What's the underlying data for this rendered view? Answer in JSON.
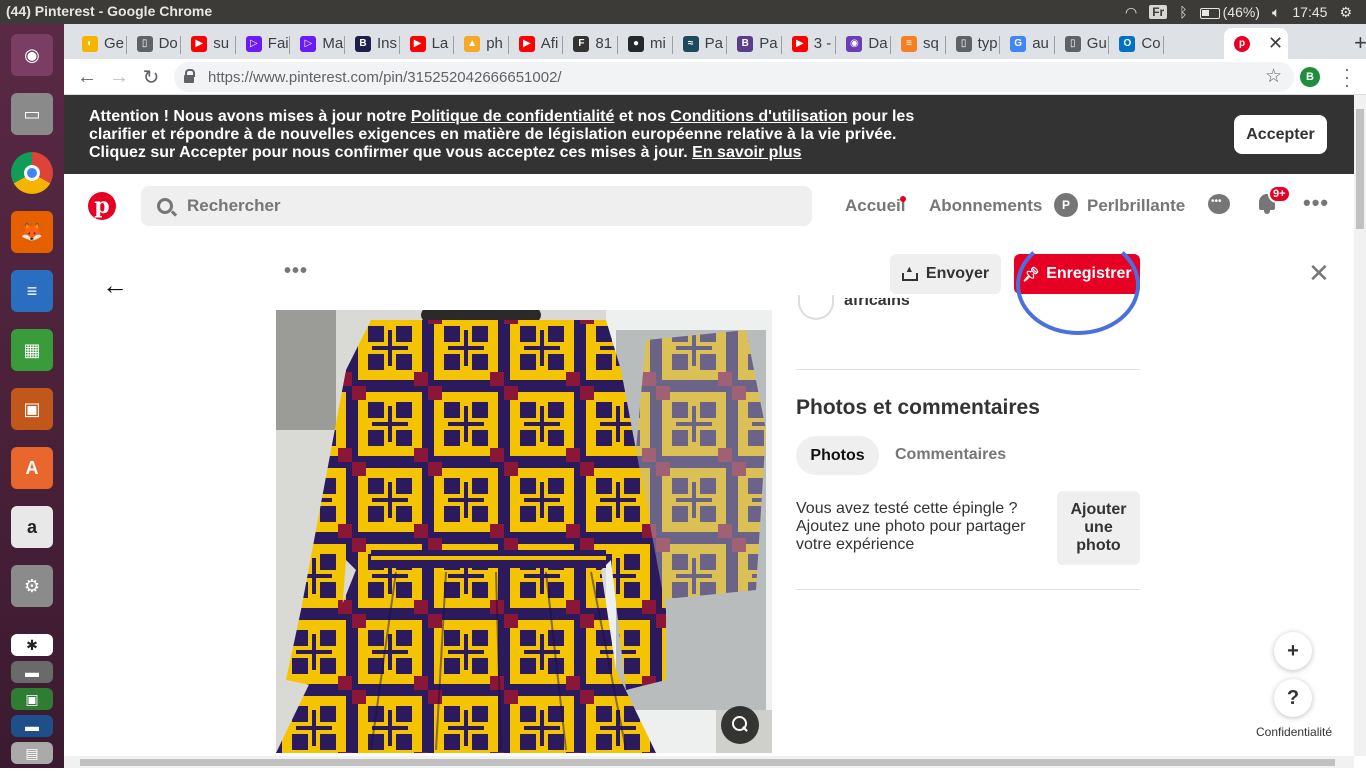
{
  "os": {
    "window_title": "(44) Pinterest - Google Chrome",
    "keyboard_layout": "Fr",
    "battery": "(46%)",
    "clock": "17:45"
  },
  "launcher": [
    {
      "name": "ubuntu-dash-icon",
      "color": "#7a3e65",
      "glyph": "◉"
    },
    {
      "name": "files-icon",
      "color": "#8a8a8a",
      "glyph": "▭"
    },
    {
      "name": "chrome-icon",
      "color": "#ffffff",
      "glyph": ""
    },
    {
      "name": "firefox-icon",
      "color": "#e66000",
      "glyph": "🦊"
    },
    {
      "name": "writer-icon",
      "color": "#2a6fbf",
      "glyph": "≡"
    },
    {
      "name": "calc-icon",
      "color": "#3a9b3a",
      "glyph": "▦"
    },
    {
      "name": "impress-icon",
      "color": "#c2571c",
      "glyph": "▣"
    },
    {
      "name": "software-center-icon",
      "color": "#e9672c",
      "glyph": "A"
    },
    {
      "name": "amazon-icon",
      "color": "#e8e8e8",
      "glyph": "a"
    },
    {
      "name": "settings-icon",
      "color": "#8b8b8b",
      "glyph": "⚙"
    },
    {
      "name": "slack-icon",
      "color": "#ffffff",
      "glyph": "✱"
    },
    {
      "name": "drive-icon",
      "color": "#6a6a6a",
      "glyph": "▬"
    },
    {
      "name": "screenshot-icon",
      "color": "#2e7d32",
      "glyph": "▣"
    },
    {
      "name": "scanner-icon",
      "color": "#1e4f8a",
      "glyph": "▬"
    },
    {
      "name": "trash-icon",
      "color": "#aaaaaa",
      "glyph": "▤"
    }
  ],
  "browser": {
    "tabs": [
      {
        "label": "Ge",
        "fav_color": "#f4b400",
        "fav": "◐"
      },
      {
        "label": "Do",
        "fav_color": "#5f6368",
        "fav": "▯"
      },
      {
        "label": "su",
        "fav_color": "#ff0000",
        "fav": "▶"
      },
      {
        "label": "Fai",
        "fav_color": "#6a1cf6",
        "fav": "▷"
      },
      {
        "label": "Ma",
        "fav_color": "#6a1cf6",
        "fav": "▷"
      },
      {
        "label": "Ins",
        "fav_color": "#1d1f4a",
        "fav": "B"
      },
      {
        "label": "La",
        "fav_color": "#ff0000",
        "fav": "▶"
      },
      {
        "label": "ph",
        "fav_color": "#f9a825",
        "fav": "▲"
      },
      {
        "label": "Afi",
        "fav_color": "#ff0000",
        "fav": "▶"
      },
      {
        "label": "81",
        "fav_color": "#333333",
        "fav": "F"
      },
      {
        "label": "mi",
        "fav_color": "#24292e",
        "fav": "●"
      },
      {
        "label": "Pa",
        "fav_color": "#1b4a5a",
        "fav": "≈"
      },
      {
        "label": "Pa",
        "fav_color": "#5c3b8a",
        "fav": "B"
      },
      {
        "label": "3 -",
        "fav_color": "#ff0000",
        "fav": "▶"
      },
      {
        "label": "Da",
        "fav_color": "#6a3fb5",
        "fav": "◉"
      },
      {
        "label": "sq",
        "fav_color": "#f48024",
        "fav": "≡"
      },
      {
        "label": "typ",
        "fav_color": "#5f6368",
        "fav": "▯"
      },
      {
        "label": "au",
        "fav_color": "#4285f4",
        "fav": "G"
      },
      {
        "label": "Gu",
        "fav_color": "#5f6368",
        "fav": "▯"
      },
      {
        "label": "Co",
        "fav_color": "#0072c6",
        "fav": "O"
      }
    ],
    "active_tab_close": "✕",
    "new_tab": "+",
    "url_host": "https://www.pinterest.com",
    "url_path": "/pin/315252042666651002/",
    "profile_initial": "B"
  },
  "consent": {
    "line1_a": "Attention ! Nous avons mises à jour notre ",
    "link_privacy": "Politique de confidentialité",
    "line1_b": " et nos ",
    "link_terms": "Conditions d'utilisation",
    "line1_c": " pour les",
    "line2": "clarifier et répondre à de nouvelles exigences en matière de législation européenne relative à la vie privée.",
    "line3_a": "Cliquez sur Accepter pour nous confirmer que vous acceptez ces mises à jour. ",
    "link_more": "En savoir plus",
    "accept_label": "Accepter"
  },
  "header": {
    "logo": "p",
    "search_placeholder": "Rechercher",
    "home": "Accueil",
    "following": "Abonnements",
    "avatar_initial": "P",
    "username": "Perlbrillante",
    "notif_badge": "9+",
    "more": "•••"
  },
  "pin": {
    "back": "←",
    "more": "•••",
    "send_label": "Envoyer",
    "save_label": "Enregistrer",
    "close": "✕",
    "board_name_partial": "africains",
    "photos_heading": "Photos et commentaires",
    "tab_photos": "Photos",
    "tab_comments": "Commentaires",
    "tried_text": "Vous avez testé cette épingle ? Ajoutez une photo pour partager votre expérience",
    "add_photo_label": "Ajouter une photo"
  },
  "floating": {
    "plus": "+",
    "help": "?",
    "privacy": "Confidentialité"
  }
}
